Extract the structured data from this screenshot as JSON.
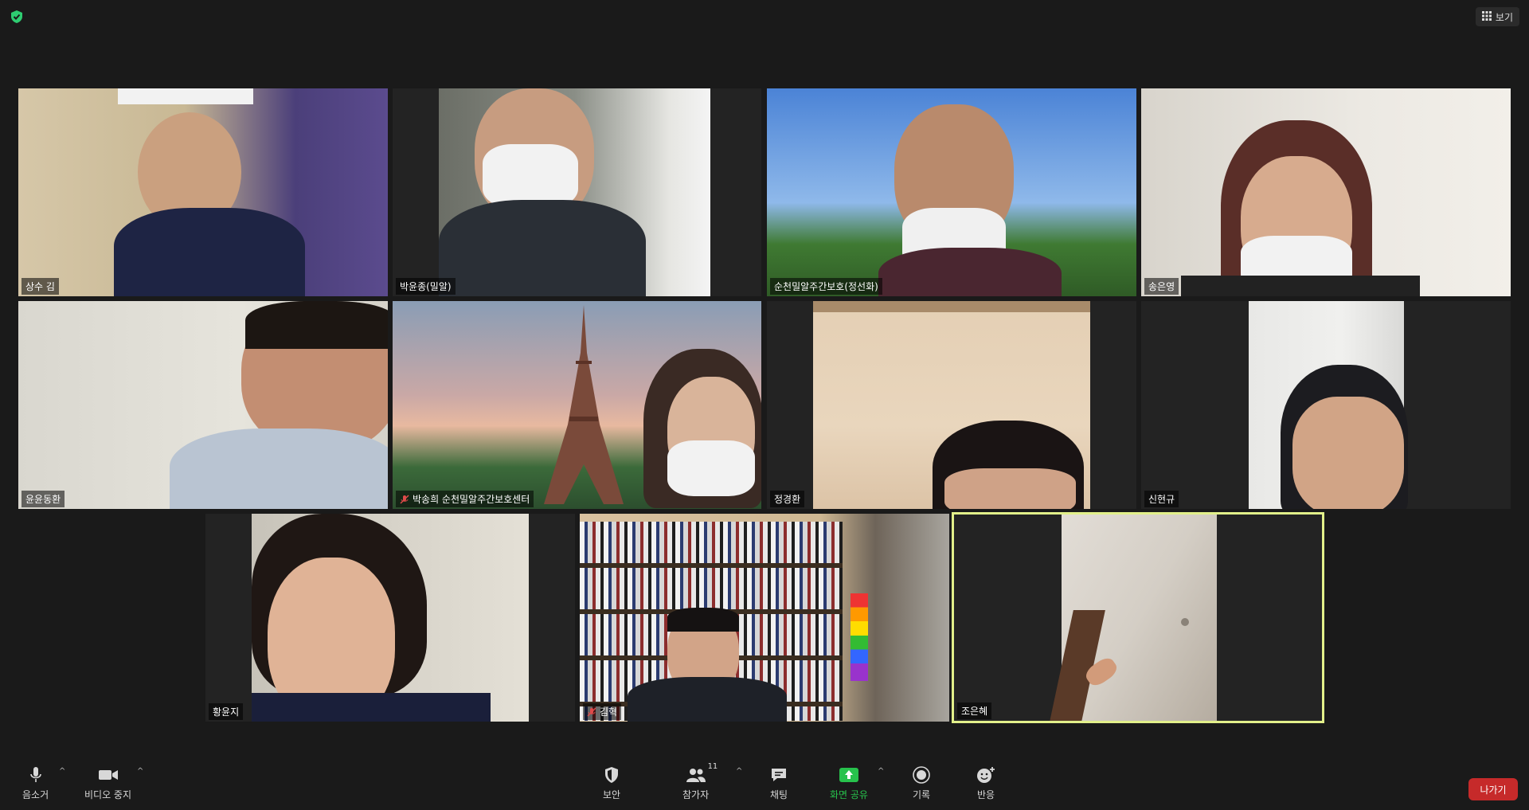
{
  "header": {
    "view_label": "보기"
  },
  "participants": [
    {
      "name": "상수 김",
      "muted": false
    },
    {
      "name": "박윤종(밀알)",
      "muted": false
    },
    {
      "name": "순천밀알주간보호(정선화)",
      "muted": false
    },
    {
      "name": "송은영",
      "muted": false
    },
    {
      "name": "윤윤동환",
      "muted": false
    },
    {
      "name": "박송희 순천밀알주간보호센터",
      "muted": true
    },
    {
      "name": "정경환",
      "muted": false
    },
    {
      "name": "신현규",
      "muted": false
    },
    {
      "name": "황윤지",
      "muted": false
    },
    {
      "name": "김혁",
      "muted": true
    },
    {
      "name": "조은혜",
      "muted": false
    }
  ],
  "toolbar": {
    "mute_label": "음소거",
    "video_label": "비디오 중지",
    "security_label": "보안",
    "participants_label": "참가자",
    "participants_count": "11",
    "chat_label": "채팅",
    "share_label": "화면 공유",
    "record_label": "기록",
    "reactions_label": "반응",
    "leave_label": "나가기"
  },
  "colors": {
    "active_speaker_border": "#e2f08a",
    "share_green": "#27c24c",
    "leave_red": "#c62a2a",
    "shield_green": "#2ecc71"
  }
}
